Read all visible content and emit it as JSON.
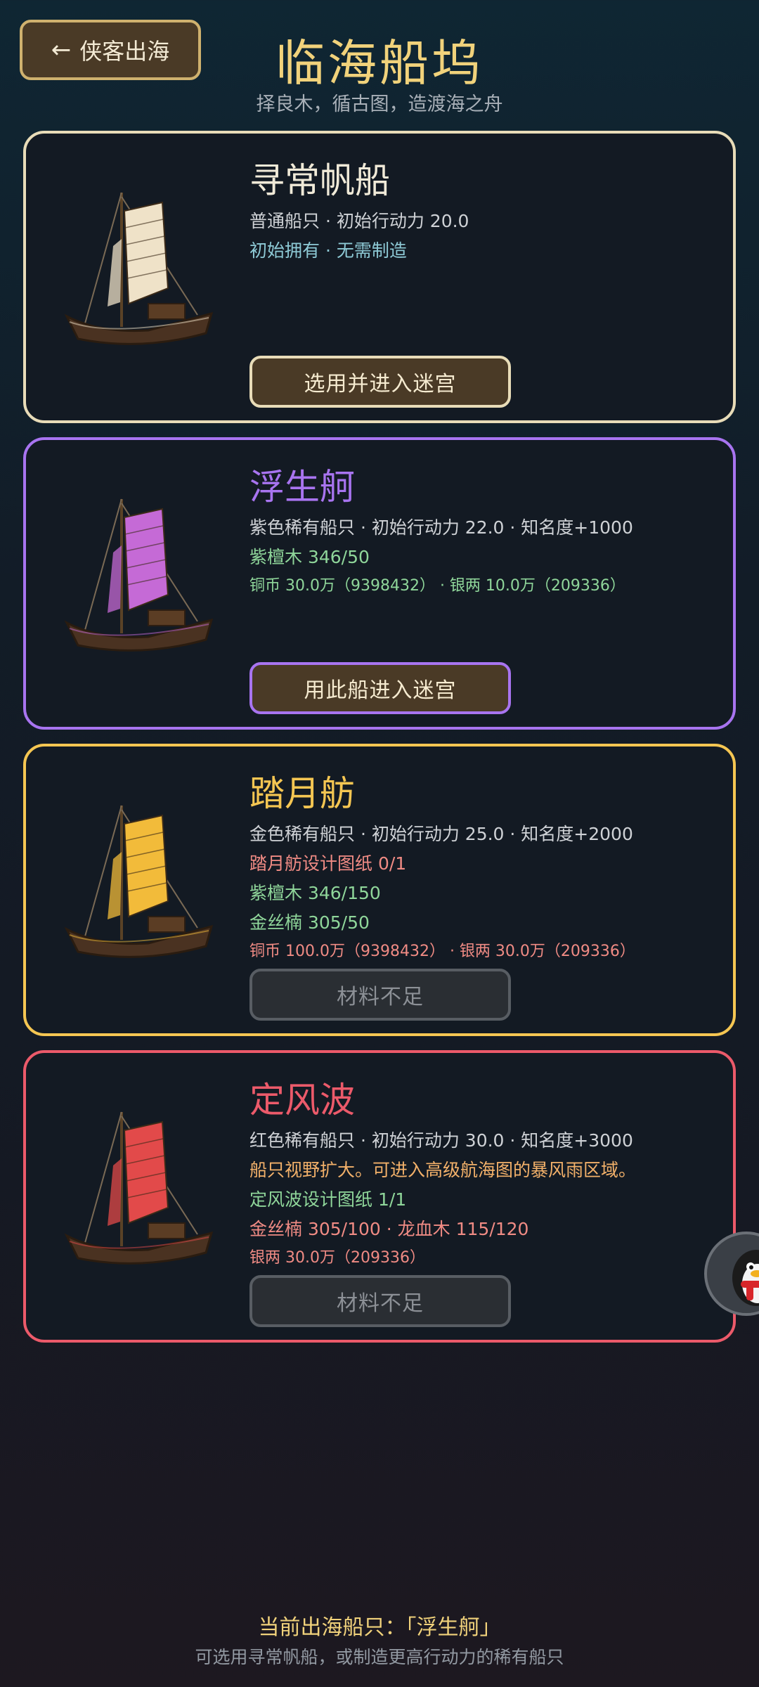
{
  "header": {
    "back_label": "侠客出海",
    "title": "临海船坞",
    "subtitle": "择良木，循古图，造渡海之舟"
  },
  "ships": [
    {
      "name": "寻常帆船",
      "accent": "#e8dcb8",
      "sail_color": "#efe2c8",
      "lines": [
        {
          "text": "普通船只 · 初始行动力 20.0",
          "style": "desc"
        },
        {
          "text": "初始拥有 · 无需制造",
          "style": "teal"
        }
      ],
      "button": {
        "label": "选用并进入迷宫",
        "state": "active"
      }
    },
    {
      "name": "浮生舸",
      "accent": "#a874f0",
      "sail_color": "#c56ad6",
      "lines": [
        {
          "text": "紫色稀有船只 · 初始行动力 22.0 · 知名度+1000",
          "style": "desc"
        },
        {
          "text": "紫檀木  346/50",
          "style": "green"
        },
        {
          "text": "铜币 30.0万（9398432） · 银两 10.0万（209336）",
          "style": "green small"
        }
      ],
      "button": {
        "label": "用此船进入迷宫",
        "state": "active"
      }
    },
    {
      "name": "踏月舫",
      "accent": "#f5c652",
      "sail_color": "#f2bb3a",
      "lines": [
        {
          "text": "金色稀有船只 · 初始行动力 25.0 · 知名度+2000",
          "style": "desc"
        },
        {
          "text": "踏月舫设计图纸  0/1",
          "style": "red"
        },
        {
          "text": "紫檀木  346/150",
          "style": "green"
        },
        {
          "text": "金丝楠  305/50",
          "style": "green"
        },
        {
          "text": "铜币 100.0万（9398432） · 银两 30.0万（209336）",
          "style": "red small"
        }
      ],
      "button": {
        "label": "材料不足",
        "state": "disabled"
      }
    },
    {
      "name": "定风波",
      "accent": "#ec5a6a",
      "sail_color": "#e24a4a",
      "lines": [
        {
          "text": "红色稀有船只 · 初始行动力 30.0 · 知名度+3000",
          "style": "desc"
        },
        {
          "text": "船只视野扩大。可进入高级航海图的暴风雨区域。",
          "style": "orange"
        },
        {
          "text": "定风波设计图纸  1/1",
          "style": "green"
        },
        {
          "text": "金丝楠 305/100 · 龙血木 115/120",
          "style": "red"
        },
        {
          "text": "银两 30.0万（209336）",
          "style": "red small"
        }
      ],
      "button": {
        "label": "材料不足",
        "state": "disabled"
      }
    }
  ],
  "footer": {
    "current_ship": "当前出海船只：「浮生舸」",
    "hint": "可选用寻常帆船，或制造更高行动力的稀有船只"
  }
}
